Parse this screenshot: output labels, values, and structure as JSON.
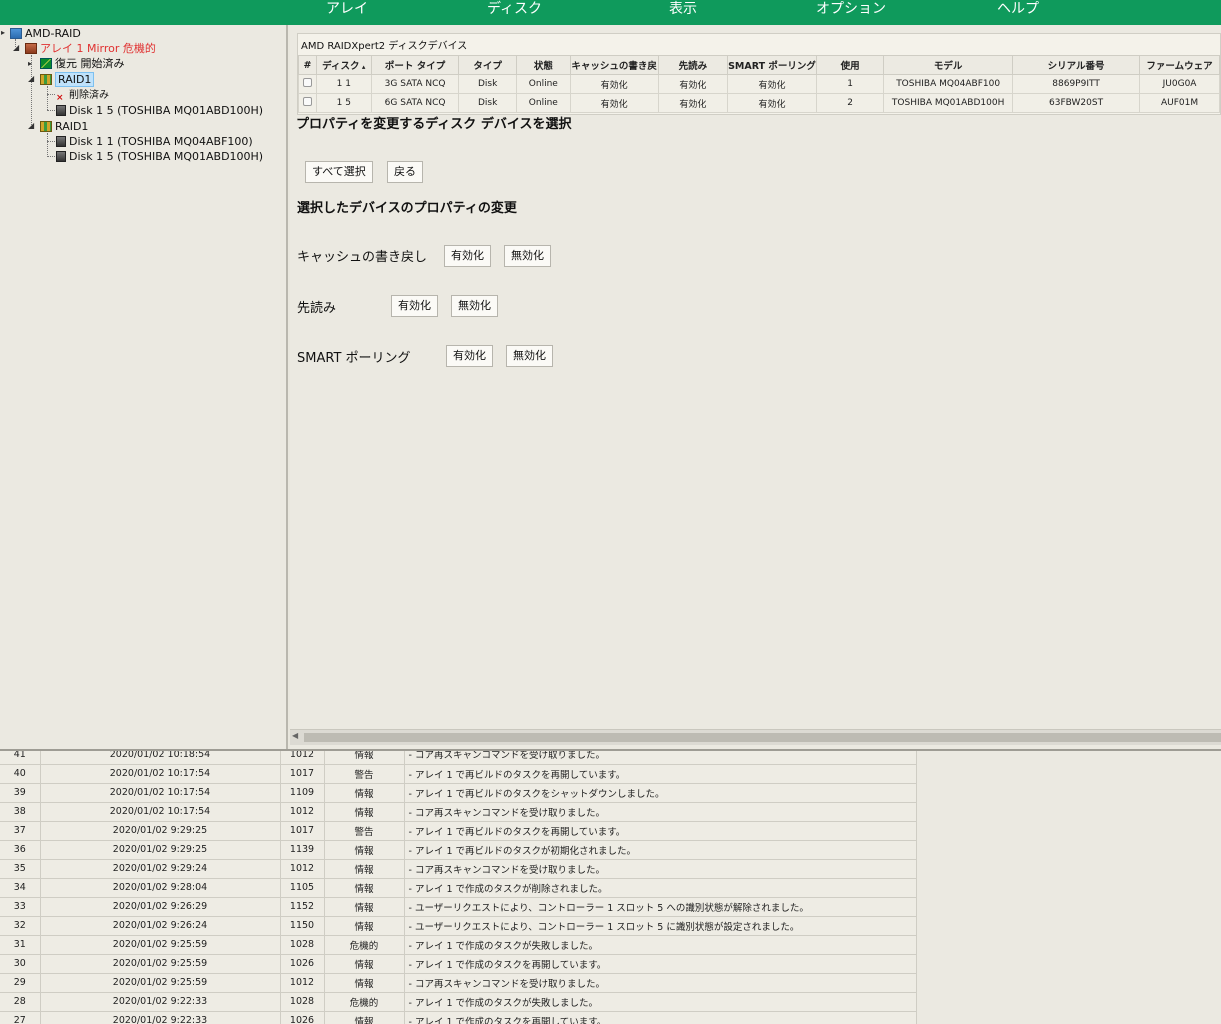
{
  "menu": [
    "アレイ",
    "ディスク",
    "表示",
    "オプション",
    "ヘルプ"
  ],
  "tree": {
    "root": "AMD-RAID",
    "array": "アレイ 1 Mirror 危機的",
    "rebuild": "復元 開始済み",
    "raid1_a": "RAID1",
    "deleted": "削除済み",
    "disk_a": "Disk 1 5 (TOSHIBA MQ01ABD100H)",
    "raid1_b": "RAID1",
    "disk_b1": "Disk 1 1 (TOSHIBA MQ04ABF100)",
    "disk_b2": "Disk 1 5 (TOSHIBA MQ01ABD100H)"
  },
  "disk_panel": {
    "title": "AMD RAIDXpert2 ディスクデバイス",
    "headers": [
      "#",
      "ディスク",
      "ポート タイプ",
      "タイプ",
      "状態",
      "キャッシュの書き戻",
      "先読み",
      "SMART ポーリング",
      "使用",
      "モデル",
      "シリアル番号",
      "ファームウェア"
    ],
    "rows": [
      [
        "1 1",
        "3G SATA NCQ",
        "Disk",
        "Online",
        "有効化",
        "有効化",
        "有効化",
        "1",
        "TOSHIBA MQ04ABF100",
        "8869P9ITT",
        "JU0G0A"
      ],
      [
        "1 5",
        "6G SATA NCQ",
        "Disk",
        "Online",
        "有効化",
        "有効化",
        "有効化",
        "2",
        "TOSHIBA MQ01ABD100H",
        "63FBW20ST",
        "AUF01M"
      ]
    ]
  },
  "select_title": "プロパティを変更するディスク デバイスを選択",
  "select_all": "すべて選択",
  "back": "戻る",
  "change_title": "選択したデバイスのプロパティの変更",
  "props": {
    "cache": "キャッシュの書き戻し",
    "readahead": "先読み",
    "smart": "SMART ポーリング",
    "enable": "有効化",
    "disable": "無効化"
  },
  "log": [
    [
      "41",
      "2020/01/02 10:18:54",
      "1012",
      "情報",
      "- コア再スキャンコマンドを受け取りました。"
    ],
    [
      "40",
      "2020/01/02 10:17:54",
      "1017",
      "警告",
      "- アレイ 1 で再ビルドのタスクを再開しています。"
    ],
    [
      "39",
      "2020/01/02 10:17:54",
      "1109",
      "情報",
      "- アレイ 1 で再ビルドのタスクをシャットダウンしました。"
    ],
    [
      "38",
      "2020/01/02 10:17:54",
      "1012",
      "情報",
      "- コア再スキャンコマンドを受け取りました。"
    ],
    [
      "37",
      "2020/01/02 9:29:25",
      "1017",
      "警告",
      "- アレイ 1 で再ビルドのタスクを再開しています。"
    ],
    [
      "36",
      "2020/01/02 9:29:25",
      "1139",
      "情報",
      "- アレイ 1 で再ビルドのタスクが初期化されました。"
    ],
    [
      "35",
      "2020/01/02 9:29:24",
      "1012",
      "情報",
      "- コア再スキャンコマンドを受け取りました。"
    ],
    [
      "34",
      "2020/01/02 9:28:04",
      "1105",
      "情報",
      "- アレイ 1 で作成のタスクが削除されました。"
    ],
    [
      "33",
      "2020/01/02 9:26:29",
      "1152",
      "情報",
      "- ユーザーリクエストにより、コントローラー 1 スロット 5 への識別状態が解除されました。"
    ],
    [
      "32",
      "2020/01/02 9:26:24",
      "1150",
      "情報",
      "- ユーザーリクエストにより、コントローラー 1 スロット 5 に識別状態が設定されました。"
    ],
    [
      "31",
      "2020/01/02 9:25:59",
      "1028",
      "危機的",
      "- アレイ 1 で作成のタスクが失敗しました。"
    ],
    [
      "30",
      "2020/01/02 9:25:59",
      "1026",
      "情報",
      "- アレイ 1 で作成のタスクを再開しています。"
    ],
    [
      "29",
      "2020/01/02 9:25:59",
      "1012",
      "情報",
      "- コア再スキャンコマンドを受け取りました。"
    ],
    [
      "28",
      "2020/01/02 9:22:33",
      "1028",
      "危機的",
      "- アレイ 1 で作成のタスクが失敗しました。"
    ],
    [
      "27",
      "2020/01/02 9:22:33",
      "1026",
      "情報",
      "- アレイ 1 で作成のタスクを再開しています。"
    ]
  ]
}
